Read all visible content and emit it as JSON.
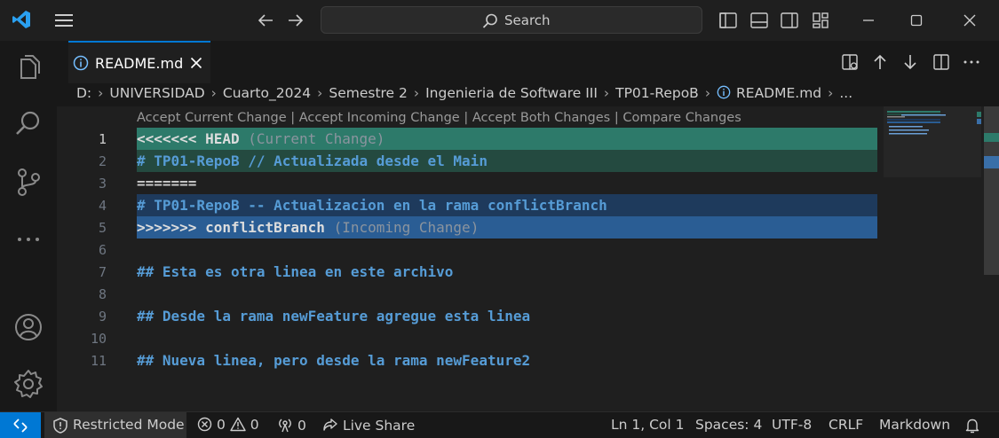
{
  "titlebar": {
    "search_label": "Search"
  },
  "tab": {
    "label": "README.md"
  },
  "breadcrumb": [
    "D:",
    "UNIVERSIDAD",
    "Cuarto_2024",
    "Semestre 2",
    "Ingenieria de Software III",
    "TP01-RepoB",
    "README.md",
    "..."
  ],
  "codelens": "Accept Current Change | Accept Incoming Change | Accept Both Changes | Compare Changes",
  "lines": [
    {
      "n": "1",
      "marker": "<<<<<<< HEAD",
      "hint": "(Current Change)"
    },
    {
      "n": "2",
      "text": "# TP01-RepoB // Actualizada desde el Main"
    },
    {
      "n": "3",
      "text": "======="
    },
    {
      "n": "4",
      "text": "# TP01-RepoB -- Actualizacion en la rama conflictBranch"
    },
    {
      "n": "5",
      "marker": ">>>>>>> conflictBranch",
      "hint": "(Incoming Change)"
    },
    {
      "n": "6",
      "text": ""
    },
    {
      "n": "7",
      "text": "## Esta es otra linea en este archivo"
    },
    {
      "n": "8",
      "text": ""
    },
    {
      "n": "9",
      "text": "## Desde la rama newFeature agregue esta linea"
    },
    {
      "n": "10",
      "text": ""
    },
    {
      "n": "11",
      "text": "## Nueva linea, pero desde la rama newFeature2"
    }
  ],
  "statusbar": {
    "restricted_mode": "Restricted Mode",
    "errors": "0",
    "warnings": "0",
    "ports": "0",
    "live_share": "Live Share",
    "position": "Ln 1, Col 1",
    "spaces": "Spaces: 4",
    "encoding": "UTF-8",
    "eol": "CRLF",
    "language": "Markdown"
  },
  "colors": {
    "accent": "#0078d4",
    "current_change_header": "#2d7a6a",
    "current_change_body": "#244a40",
    "incoming_change_body": "#1e3a5c",
    "incoming_change_header": "#2a5d94",
    "markdown_heading": "#569cd6"
  }
}
